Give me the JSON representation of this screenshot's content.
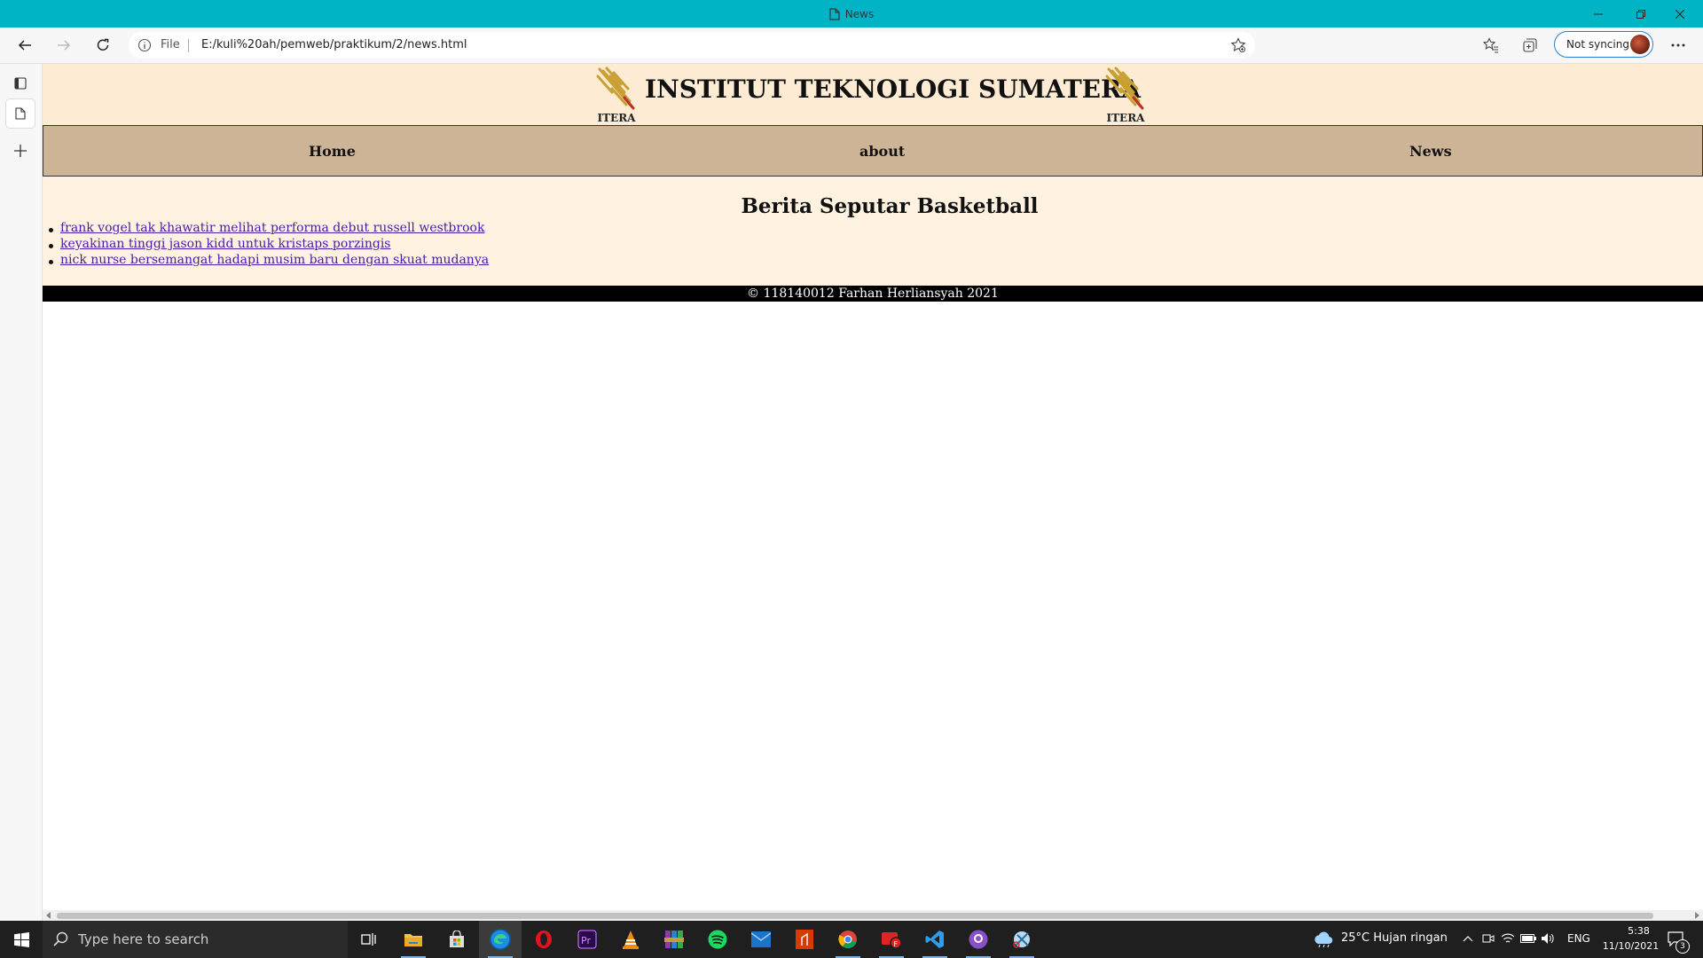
{
  "window": {
    "title": "News"
  },
  "browser": {
    "address": {
      "scheme_label": "File",
      "url": "E:/kuli%20ah/pemweb/praktikum/2/news.html"
    },
    "profile_label": "Not syncing"
  },
  "site": {
    "title": "INSTITUT TEKNOLOGI SUMATERA",
    "logo_text": "ITERA",
    "nav": [
      {
        "label": "Home"
      },
      {
        "label": "about"
      },
      {
        "label": "News"
      }
    ],
    "heading": "Berita Seputar Basketball",
    "news": [
      {
        "label": "frank vogel tak khawatir melihat performa debut russell westbrook"
      },
      {
        "label": "keyakinan tinggi jason kidd untuk kristaps porzingis"
      },
      {
        "label": "nick nurse bersemangat hadapi musim baru dengan skuat mudanya"
      }
    ],
    "footer": "© 118140012 Farhan Herliansyah 2021"
  },
  "taskbar": {
    "search_placeholder": "Type here to search",
    "weather": "25°C  Hujan ringan",
    "language": "ENG",
    "time": "5:38",
    "date": "11/10/2021",
    "notifications": "3",
    "apps": [
      "task-view",
      "file-explorer",
      "microsoft-store",
      "edge",
      "opera",
      "premiere-pro",
      "vlc",
      "winrar",
      "spotify",
      "mail",
      "office",
      "chrome",
      "app-red",
      "vscode",
      "github-desktop",
      "snipping-tool"
    ]
  },
  "colors": {
    "titlebar": "#00b4c6",
    "header_bg": "#fdebd3",
    "nav_bg": "#cdb497",
    "content_bg": "#fff2e0",
    "link": "#4a1aa8",
    "footer_bg": "#000000"
  }
}
